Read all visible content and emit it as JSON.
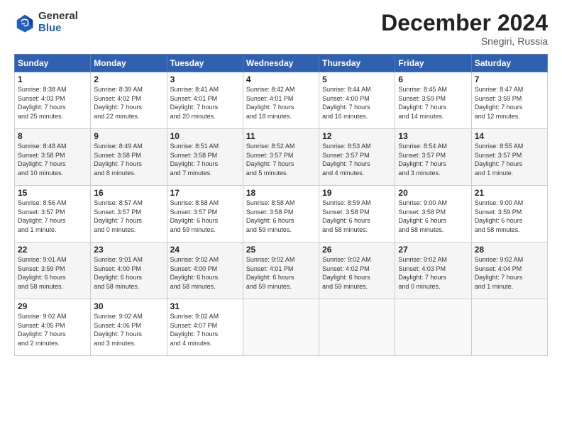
{
  "header": {
    "logo_general": "General",
    "logo_blue": "Blue",
    "month_title": "December 2024",
    "subtitle": "Snegiri, Russia"
  },
  "days_of_week": [
    "Sunday",
    "Monday",
    "Tuesday",
    "Wednesday",
    "Thursday",
    "Friday",
    "Saturday"
  ],
  "weeks": [
    [
      {
        "day": "1",
        "lines": [
          "Sunrise: 8:38 AM",
          "Sunset: 4:03 PM",
          "Daylight: 7 hours",
          "and 25 minutes."
        ]
      },
      {
        "day": "2",
        "lines": [
          "Sunrise: 8:39 AM",
          "Sunset: 4:02 PM",
          "Daylight: 7 hours",
          "and 22 minutes."
        ]
      },
      {
        "day": "3",
        "lines": [
          "Sunrise: 8:41 AM",
          "Sunset: 4:01 PM",
          "Daylight: 7 hours",
          "and 20 minutes."
        ]
      },
      {
        "day": "4",
        "lines": [
          "Sunrise: 8:42 AM",
          "Sunset: 4:01 PM",
          "Daylight: 7 hours",
          "and 18 minutes."
        ]
      },
      {
        "day": "5",
        "lines": [
          "Sunrise: 8:44 AM",
          "Sunset: 4:00 PM",
          "Daylight: 7 hours",
          "and 16 minutes."
        ]
      },
      {
        "day": "6",
        "lines": [
          "Sunrise: 8:45 AM",
          "Sunset: 3:59 PM",
          "Daylight: 7 hours",
          "and 14 minutes."
        ]
      },
      {
        "day": "7",
        "lines": [
          "Sunrise: 8:47 AM",
          "Sunset: 3:59 PM",
          "Daylight: 7 hours",
          "and 12 minutes."
        ]
      }
    ],
    [
      {
        "day": "8",
        "lines": [
          "Sunrise: 8:48 AM",
          "Sunset: 3:58 PM",
          "Daylight: 7 hours",
          "and 10 minutes."
        ]
      },
      {
        "day": "9",
        "lines": [
          "Sunrise: 8:49 AM",
          "Sunset: 3:58 PM",
          "Daylight: 7 hours",
          "and 8 minutes."
        ]
      },
      {
        "day": "10",
        "lines": [
          "Sunrise: 8:51 AM",
          "Sunset: 3:58 PM",
          "Daylight: 7 hours",
          "and 7 minutes."
        ]
      },
      {
        "day": "11",
        "lines": [
          "Sunrise: 8:52 AM",
          "Sunset: 3:57 PM",
          "Daylight: 7 hours",
          "and 5 minutes."
        ]
      },
      {
        "day": "12",
        "lines": [
          "Sunrise: 8:53 AM",
          "Sunset: 3:57 PM",
          "Daylight: 7 hours",
          "and 4 minutes."
        ]
      },
      {
        "day": "13",
        "lines": [
          "Sunrise: 8:54 AM",
          "Sunset: 3:57 PM",
          "Daylight: 7 hours",
          "and 3 minutes."
        ]
      },
      {
        "day": "14",
        "lines": [
          "Sunrise: 8:55 AM",
          "Sunset: 3:57 PM",
          "Daylight: 7 hours",
          "and 1 minute."
        ]
      }
    ],
    [
      {
        "day": "15",
        "lines": [
          "Sunrise: 8:56 AM",
          "Sunset: 3:57 PM",
          "Daylight: 7 hours",
          "and 1 minute."
        ]
      },
      {
        "day": "16",
        "lines": [
          "Sunrise: 8:57 AM",
          "Sunset: 3:57 PM",
          "Daylight: 7 hours",
          "and 0 minutes."
        ]
      },
      {
        "day": "17",
        "lines": [
          "Sunrise: 8:58 AM",
          "Sunset: 3:57 PM",
          "Daylight: 6 hours",
          "and 59 minutes."
        ]
      },
      {
        "day": "18",
        "lines": [
          "Sunrise: 8:58 AM",
          "Sunset: 3:58 PM",
          "Daylight: 6 hours",
          "and 59 minutes."
        ]
      },
      {
        "day": "19",
        "lines": [
          "Sunrise: 8:59 AM",
          "Sunset: 3:58 PM",
          "Daylight: 6 hours",
          "and 58 minutes."
        ]
      },
      {
        "day": "20",
        "lines": [
          "Sunrise: 9:00 AM",
          "Sunset: 3:58 PM",
          "Daylight: 6 hours",
          "and 58 minutes."
        ]
      },
      {
        "day": "21",
        "lines": [
          "Sunrise: 9:00 AM",
          "Sunset: 3:59 PM",
          "Daylight: 6 hours",
          "and 58 minutes."
        ]
      }
    ],
    [
      {
        "day": "22",
        "lines": [
          "Sunrise: 9:01 AM",
          "Sunset: 3:59 PM",
          "Daylight: 6 hours",
          "and 58 minutes."
        ]
      },
      {
        "day": "23",
        "lines": [
          "Sunrise: 9:01 AM",
          "Sunset: 4:00 PM",
          "Daylight: 6 hours",
          "and 58 minutes."
        ]
      },
      {
        "day": "24",
        "lines": [
          "Sunrise: 9:02 AM",
          "Sunset: 4:00 PM",
          "Daylight: 6 hours",
          "and 58 minutes."
        ]
      },
      {
        "day": "25",
        "lines": [
          "Sunrise: 9:02 AM",
          "Sunset: 4:01 PM",
          "Daylight: 6 hours",
          "and 59 minutes."
        ]
      },
      {
        "day": "26",
        "lines": [
          "Sunrise: 9:02 AM",
          "Sunset: 4:02 PM",
          "Daylight: 6 hours",
          "and 59 minutes."
        ]
      },
      {
        "day": "27",
        "lines": [
          "Sunrise: 9:02 AM",
          "Sunset: 4:03 PM",
          "Daylight: 7 hours",
          "and 0 minutes."
        ]
      },
      {
        "day": "28",
        "lines": [
          "Sunrise: 9:02 AM",
          "Sunset: 4:04 PM",
          "Daylight: 7 hours",
          "and 1 minute."
        ]
      }
    ],
    [
      {
        "day": "29",
        "lines": [
          "Sunrise: 9:02 AM",
          "Sunset: 4:05 PM",
          "Daylight: 7 hours",
          "and 2 minutes."
        ]
      },
      {
        "day": "30",
        "lines": [
          "Sunrise: 9:02 AM",
          "Sunset: 4:06 PM",
          "Daylight: 7 hours",
          "and 3 minutes."
        ]
      },
      {
        "day": "31",
        "lines": [
          "Sunrise: 9:02 AM",
          "Sunset: 4:07 PM",
          "Daylight: 7 hours",
          "and 4 minutes."
        ]
      },
      null,
      null,
      null,
      null
    ]
  ]
}
